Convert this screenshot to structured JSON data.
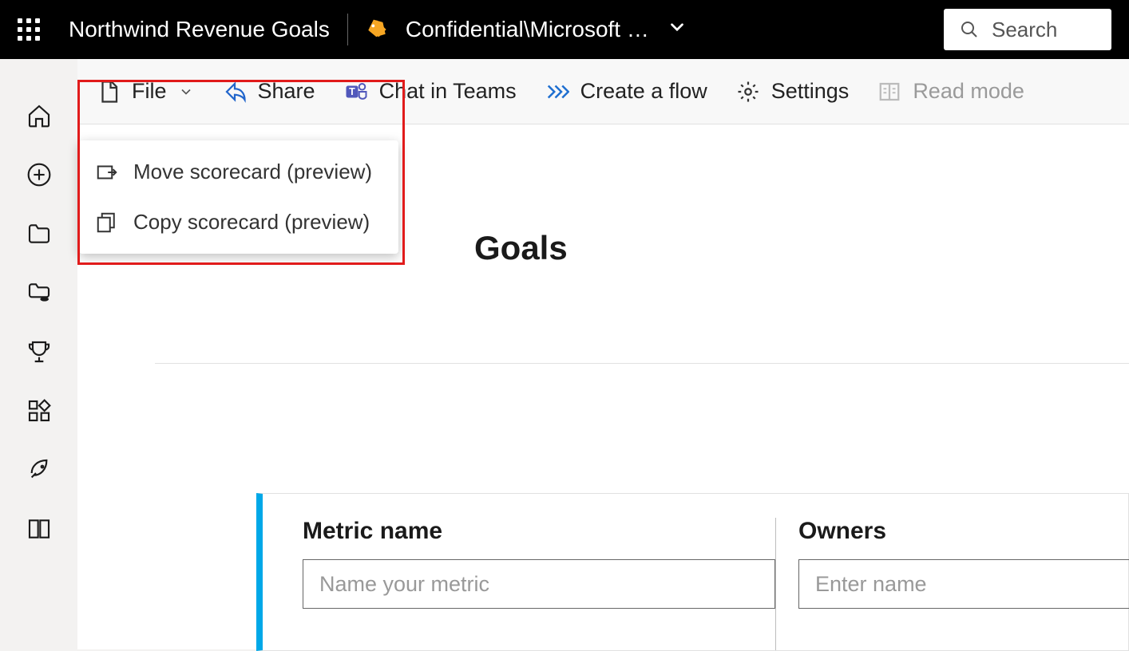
{
  "header": {
    "title": "Northwind Revenue Goals",
    "sensitivity": "Confidential\\Microsoft …",
    "search_placeholder": "Search"
  },
  "cmdbar": {
    "file": "File",
    "share": "Share",
    "chat": "Chat in Teams",
    "flow": "Create a flow",
    "settings": "Settings",
    "readmode": "Read mode"
  },
  "file_menu": {
    "move": "Move scorecard (preview)",
    "copy": "Copy scorecard (preview)"
  },
  "page": {
    "title_fragment": "Goals"
  },
  "form": {
    "metric_label": "Metric name",
    "metric_placeholder": "Name your metric",
    "owners_label": "Owners",
    "owners_placeholder": "Enter name"
  }
}
